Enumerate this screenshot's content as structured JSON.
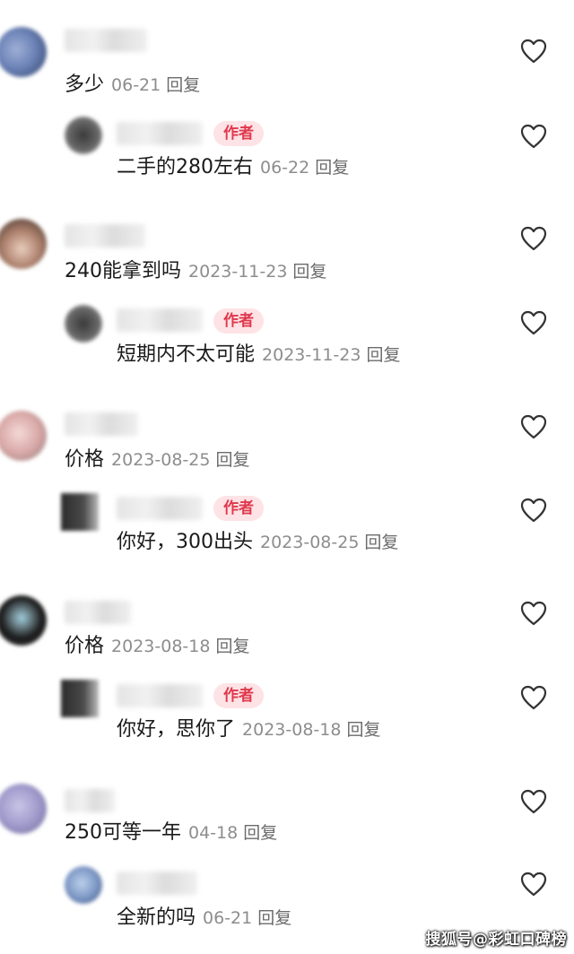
{
  "reply_label": "回复",
  "author_label": "作者",
  "watermark": "搜狐号@彩虹口碑榜",
  "comments": [
    {
      "content": "多少",
      "date": "06-21",
      "reply": {
        "content": "二手的280左右",
        "date": "06-22"
      }
    },
    {
      "content": "240能拿到吗",
      "date": "2023-11-23",
      "reply": {
        "content": "短期内不太可能",
        "date": "2023-11-23"
      }
    },
    {
      "content": "价格",
      "date": "2023-08-25",
      "reply": {
        "content": "你好，300出头",
        "date": "2023-08-25"
      }
    },
    {
      "content": "价格",
      "date": "2023-08-18",
      "reply": {
        "content": "你好，思你了",
        "date": "2023-08-18"
      }
    },
    {
      "content": "250可等一年",
      "date": "04-18",
      "reply": {
        "content": "全新的吗",
        "date": "06-21"
      }
    }
  ]
}
